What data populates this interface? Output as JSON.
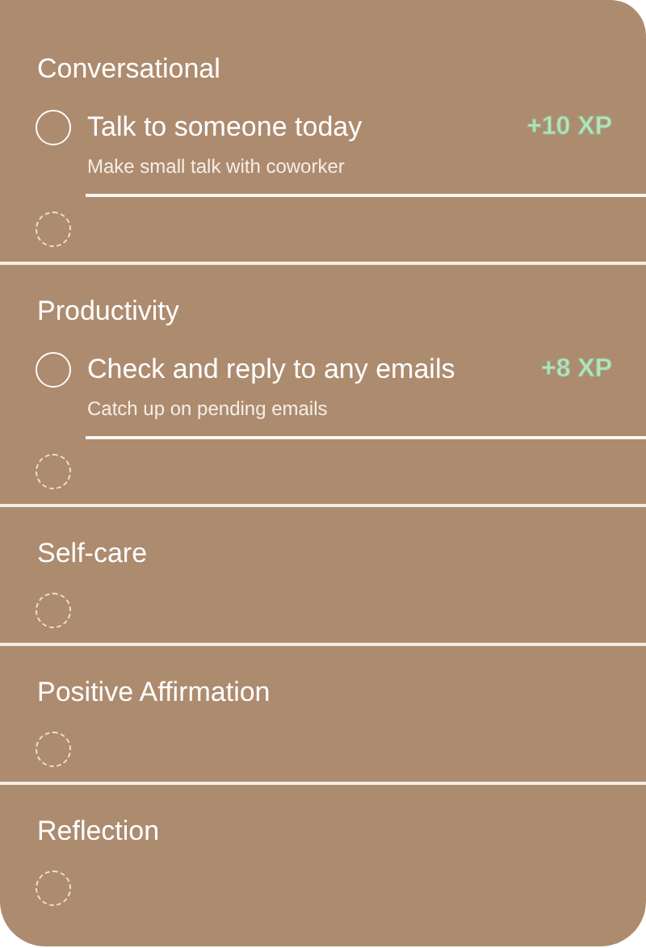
{
  "categories": [
    {
      "name": "Conversational",
      "tasks": [
        {
          "title": "Talk to someone today",
          "description": "Make small talk with coworker",
          "xp": "+10 XP",
          "checked": false
        }
      ]
    },
    {
      "name": "Productivity",
      "tasks": [
        {
          "title": "Check and reply to any emails",
          "description": "Catch up on pending emails",
          "xp": "+8 XP",
          "checked": false
        }
      ]
    },
    {
      "name": "Self-care"
    },
    {
      "name": "Positive Affirmation"
    },
    {
      "name": "Reflection"
    }
  ]
}
